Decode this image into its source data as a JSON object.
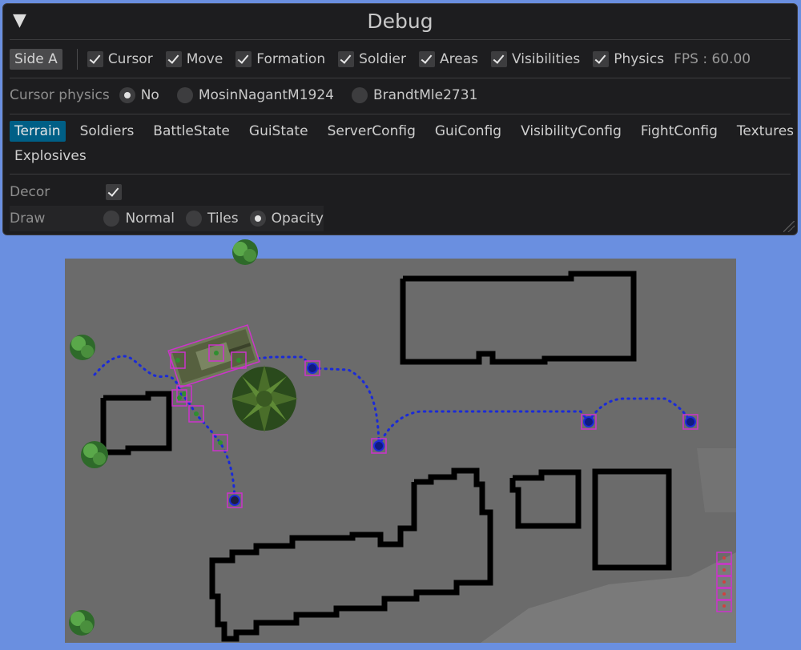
{
  "window": {
    "title": "Debug",
    "side_button": "Side A",
    "toggles": [
      {
        "label": "Cursor",
        "checked": true
      },
      {
        "label": "Move",
        "checked": true
      },
      {
        "label": "Formation",
        "checked": true
      },
      {
        "label": "Soldier",
        "checked": true
      },
      {
        "label": "Areas",
        "checked": true
      },
      {
        "label": "Visibilities",
        "checked": true
      },
      {
        "label": "Physics",
        "checked": true
      }
    ],
    "fps": "FPS : 60.00"
  },
  "cursor_physics": {
    "label": "Cursor physics",
    "options": [
      {
        "label": "No",
        "selected": true
      },
      {
        "label": "MosinNagantM1924",
        "selected": false
      },
      {
        "label": "BrandtMle2731",
        "selected": false
      }
    ]
  },
  "tabs": [
    {
      "label": "Terrain",
      "active": true
    },
    {
      "label": "Soldiers",
      "active": false
    },
    {
      "label": "BattleState",
      "active": false
    },
    {
      "label": "GuiState",
      "active": false
    },
    {
      "label": "ServerConfig",
      "active": false
    },
    {
      "label": "GuiConfig",
      "active": false
    },
    {
      "label": "VisibilityConfig",
      "active": false
    },
    {
      "label": "FightConfig",
      "active": false
    },
    {
      "label": "Textures",
      "active": false
    },
    {
      "label": "Explosives",
      "active": false
    }
  ],
  "terrain": {
    "decor": {
      "label": "Decor",
      "checked": true
    },
    "draw": {
      "label": "Draw",
      "options": [
        {
          "label": "Normal",
          "selected": false
        },
        {
          "label": "Tiles",
          "selected": false
        },
        {
          "label": "Opacity",
          "selected": true
        }
      ]
    }
  },
  "colors": {
    "background": "#6a8fe0",
    "map": "#6b6b6b",
    "wall": "#000000",
    "path": "#1a2ad8",
    "selection": "#cc33cc",
    "active_tab": "#005f86"
  }
}
